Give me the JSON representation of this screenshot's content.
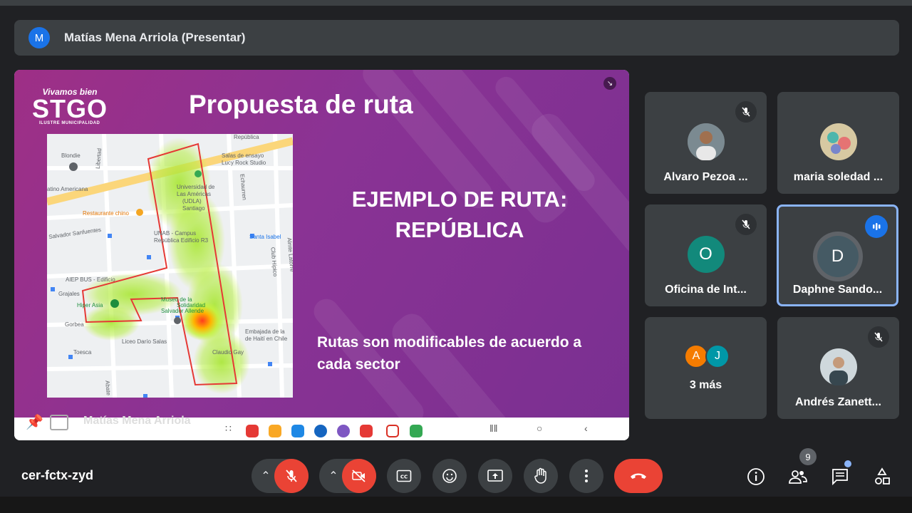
{
  "presenter": {
    "avatar_letter": "M",
    "title": "Matías Mena Arriola (Presentar)"
  },
  "slide": {
    "logo_sub": "Vivamos bien",
    "logo_main": "STGO",
    "logo_small": "ILUSTRE MUNICIPALIDAD",
    "title": "Propuesta de ruta",
    "heading_line1": "EJEMPLO DE RUTA:",
    "heading_line2": "REPÚBLICA",
    "note": "Rutas son modificables de acuerdo a cada sector",
    "map_labels": [
      "Blondie",
      "Libertad",
      "atino Americana",
      "República",
      "Salas de ensayo",
      "Lucy Rock Studio",
      "Universidad de",
      "Las Américas",
      "(UDLA)",
      "Santiago",
      "Echaurren",
      "Restaurante chino",
      "Salvador Sanfuentes",
      "UNAB - Campus",
      "República Edificio R3",
      "Santa Isabel",
      "AIEP BUS - Edificio",
      "Grajales",
      "Hiper Asia",
      "Museo de la",
      "Solidaridad",
      "Salvador Allende",
      "Gorbea",
      "Embajada de la",
      "de Haití en Chile",
      "Liceo Darío Salas",
      "Toesca",
      "Claudio Gay",
      "Club Hípico",
      "Almte Latorre",
      "Abate"
    ]
  },
  "share_strip": {
    "presenter_name": "Matías Mena Arriola"
  },
  "participants": [
    {
      "name": "Alvaro Pezoa ...",
      "muted": true
    },
    {
      "name": "maria soledad ...",
      "muted": false
    },
    {
      "name": "Oficina de Int...",
      "avatar_letter": "O",
      "avatar_color": "#12897b",
      "muted": true
    },
    {
      "name": "Daphne Sando...",
      "avatar_letter": "D",
      "avatar_color": "#455a64",
      "speaking": true
    },
    {
      "name": "3 más",
      "avatars": [
        {
          "letter": "A",
          "color": "#f57c00"
        },
        {
          "letter": "J",
          "color": "#0097a7"
        }
      ]
    },
    {
      "name": "Andrés Zanett...",
      "muted": true
    }
  ],
  "meeting": {
    "code": "cer-fctx-zyd",
    "participant_count": "9"
  },
  "colors": {
    "background": "#202124",
    "panel": "#3c4043",
    "danger": "#ea4335",
    "accent": "#8ab4f8"
  },
  "icons": {
    "mic": "mic-off-icon",
    "camera": "camera-off-icon",
    "captions": "closed-captions-icon",
    "reactions": "emoji-icon",
    "present": "present-screen-icon",
    "hand": "raise-hand-icon",
    "more": "more-options-icon",
    "end": "end-call-icon",
    "info": "info-icon",
    "people": "people-icon",
    "chat": "chat-icon",
    "activities": "activities-icon"
  }
}
